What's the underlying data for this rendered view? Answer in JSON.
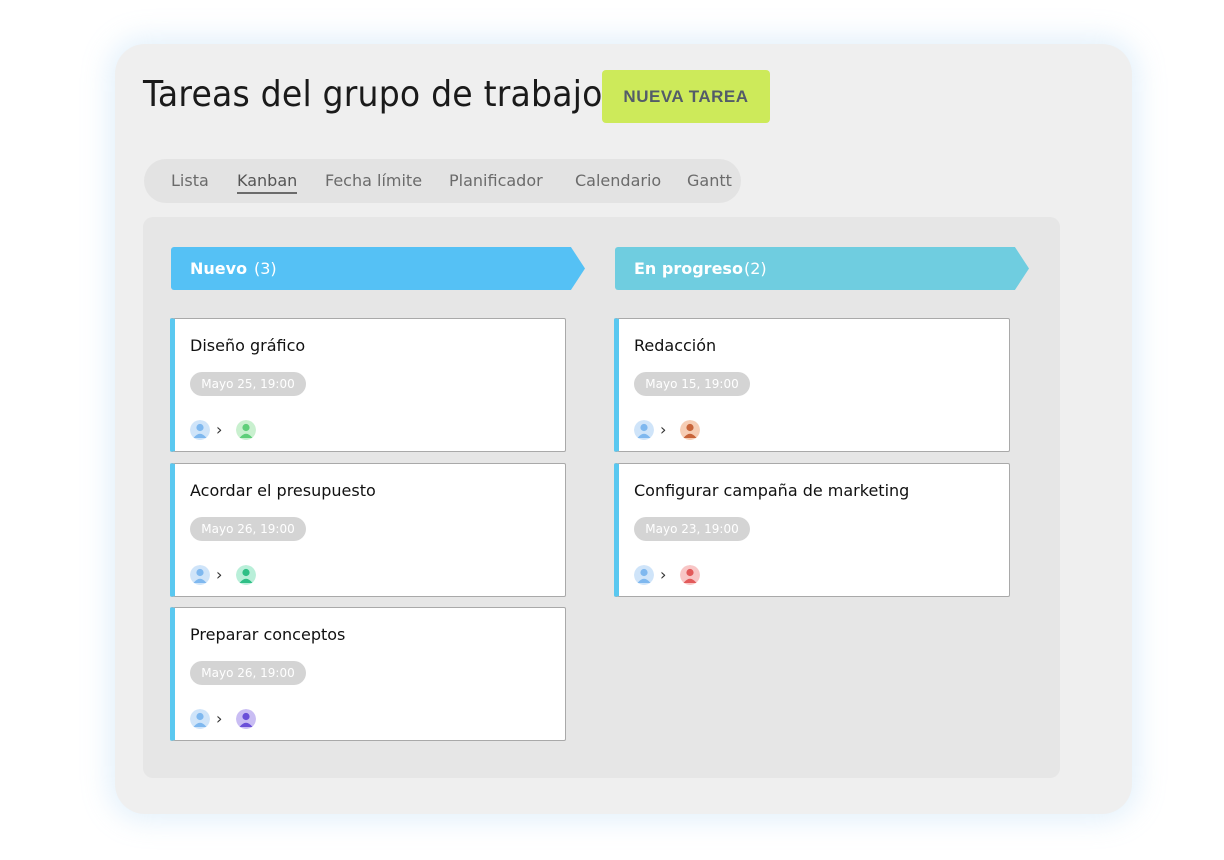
{
  "header": {
    "title": "Tareas del grupo de trabajo",
    "new_task_label": "NUEVA TAREA"
  },
  "tabs": [
    {
      "label": "Lista",
      "active": false
    },
    {
      "label": "Kanban",
      "active": true
    },
    {
      "label": "Fecha límite",
      "active": false
    },
    {
      "label": "Planificador",
      "active": false
    },
    {
      "label": "Calendario",
      "active": false
    },
    {
      "label": "Gantt",
      "active": false
    }
  ],
  "columns": [
    {
      "title": "Nuevo",
      "count": "(3)",
      "color": "#55c1f5",
      "cards": [
        {
          "title": "Diseño gráfico",
          "date": "Mayo 25, 19:00",
          "from_avatar_color": "#7fb8ef",
          "to_avatar_color": "#7fd98f"
        },
        {
          "title": "Acordar el presupuesto",
          "date": "Mayo 26, 19:00",
          "from_avatar_color": "#7fb8ef",
          "to_avatar_color": "#4fcf9a"
        },
        {
          "title": "Preparar conceptos",
          "date": "Mayo 26, 19:00",
          "from_avatar_color": "#7fb8ef",
          "to_avatar_color": "#8a6fe0"
        }
      ]
    },
    {
      "title": "En progreso",
      "count": "(2)",
      "color": "#6fcde0",
      "cards": [
        {
          "title": "Redacción",
          "date": "Mayo 15, 19:00",
          "from_avatar_color": "#7fb8ef",
          "to_avatar_color": "#e88a5a"
        },
        {
          "title": "Configurar campaña de marketing",
          "date": "Mayo 23, 19:00",
          "from_avatar_color": "#7fb8ef",
          "to_avatar_color": "#f07a7a"
        }
      ]
    }
  ],
  "colors": {
    "accent_button": "#cdea5a",
    "card_stripe": "#5ac8f0"
  },
  "icons": {
    "avatar": "user-avatar-icon",
    "arrow": "chevron-right-icon"
  }
}
